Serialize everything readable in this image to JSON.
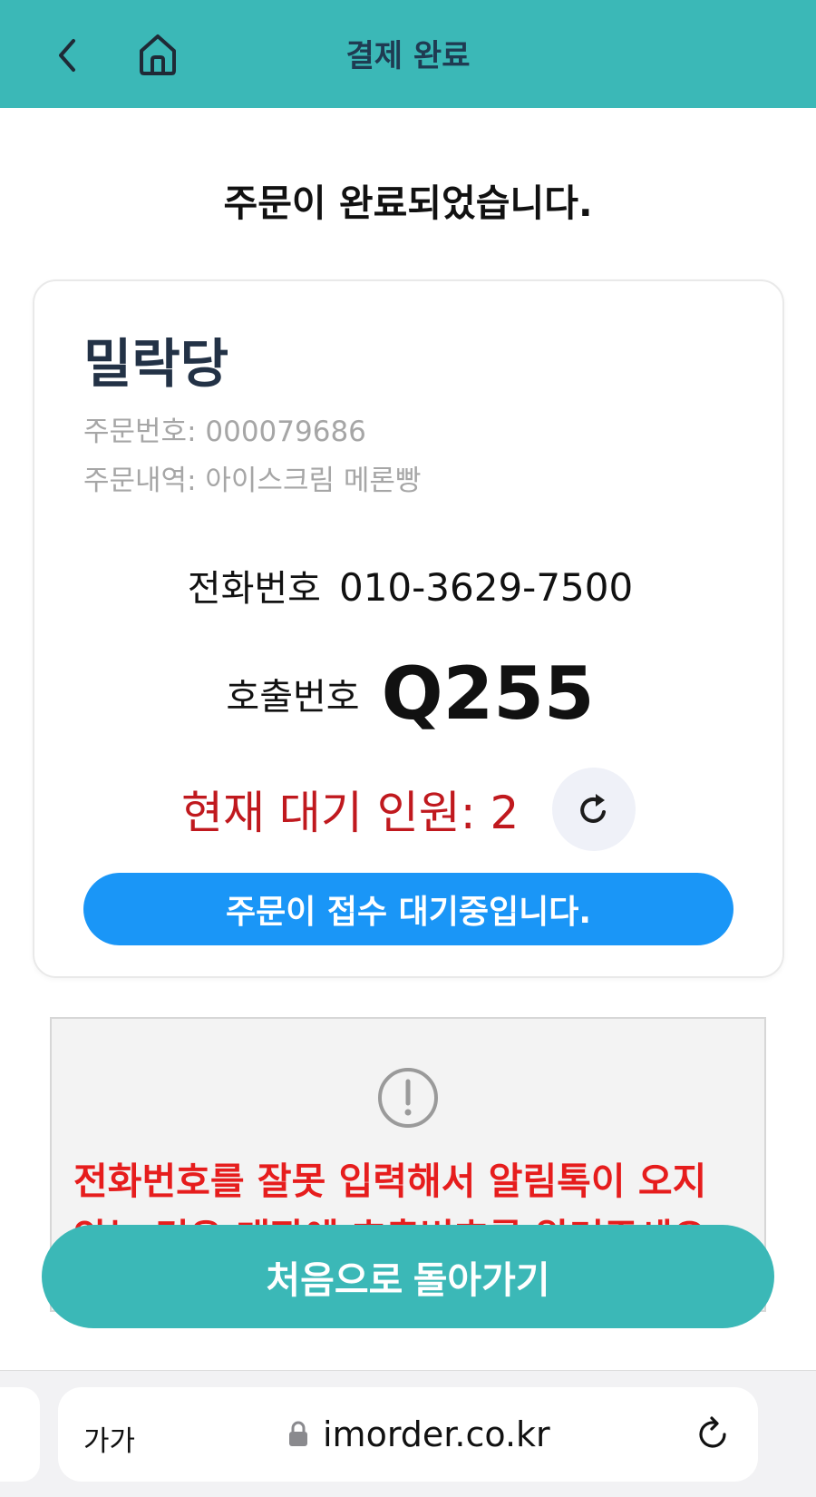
{
  "header": {
    "title": "결제 완료"
  },
  "complete_message": "주문이 완료되었습니다.",
  "order_card": {
    "store_name": "밀락당",
    "order_number": "주문번호: 000079686",
    "order_items": "주문내역: 아이스크림 메론빵",
    "phone_label": "전화번호",
    "phone_value": "010-3629-7500",
    "call_label": "호출번호",
    "call_value": "Q255",
    "waiting_text": "현재 대기 인원: 2",
    "status_text": "주문이 접수 대기중입니다."
  },
  "notice": {
    "text": "전화번호를 잘못 입력해서 알림톡이 오지 않는 경우 매장에 호출번호를 알려주세요."
  },
  "home_button": "처음으로 돌아가기",
  "browser": {
    "text_size_label": "가가",
    "url": "imorder.co.kr"
  },
  "colors": {
    "brand": "#3bb8b7",
    "status_blue": "#1a96f7",
    "alert_red": "#e61d1d",
    "wait_red": "#c0191e"
  }
}
